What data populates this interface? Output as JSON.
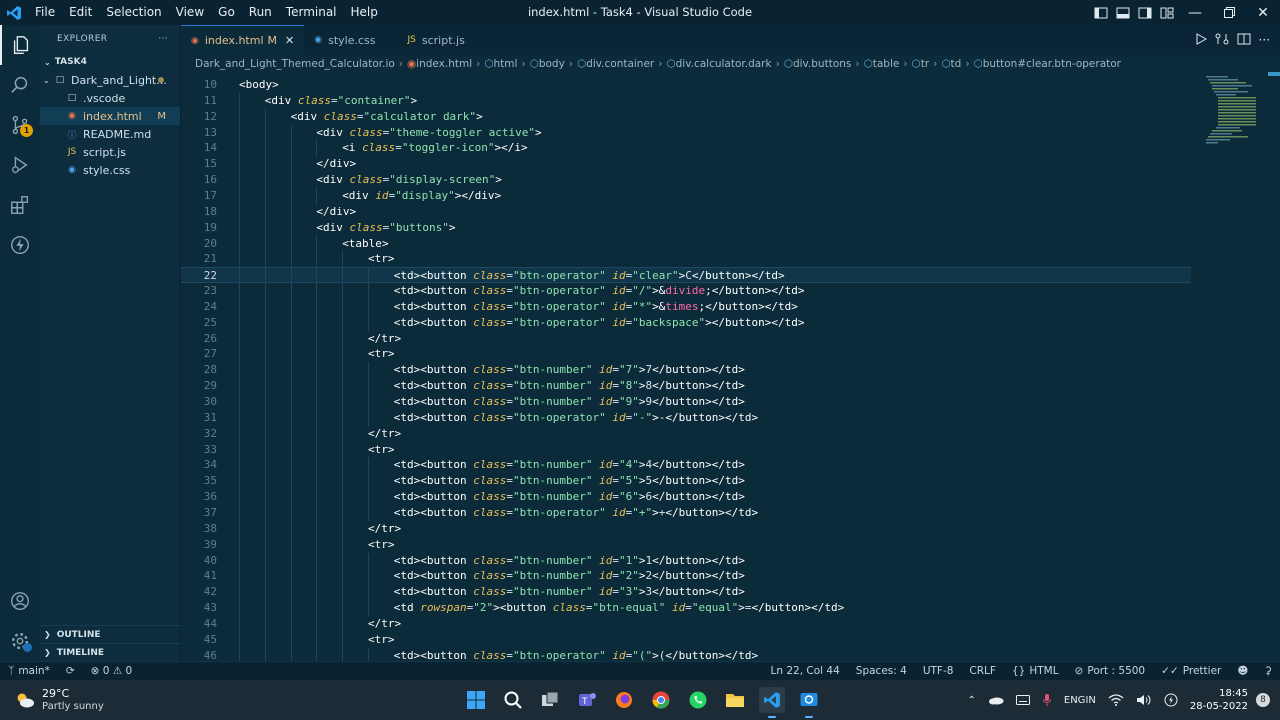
{
  "title_bar": {
    "menu": [
      "File",
      "Edit",
      "Selection",
      "View",
      "Go",
      "Run",
      "Terminal",
      "Help"
    ],
    "window_title": "index.html - Task4 - Visual Studio Code"
  },
  "activity_bar": {
    "scm_badge": "1"
  },
  "sidebar": {
    "header": "EXPLORER",
    "more": "···",
    "section": "TASK4",
    "tree": [
      {
        "label": "Dark_and_Light...",
        "type": "folder"
      },
      {
        "label": ".vscode",
        "type": "folder"
      },
      {
        "label": "index.html",
        "type": "html",
        "status": "M"
      },
      {
        "label": "README.md",
        "type": "md"
      },
      {
        "label": "script.js",
        "type": "js"
      },
      {
        "label": "style.css",
        "type": "css"
      }
    ],
    "outline": "OUTLINE",
    "timeline": "TIMELINE"
  },
  "tabs": [
    {
      "label": "index.html",
      "status": "M",
      "icon": "html-file-icon"
    },
    {
      "label": "style.css",
      "icon": "css-file-icon"
    },
    {
      "label": "script.js",
      "icon": "js-file-icon"
    }
  ],
  "breadcrumb": [
    "Dark_and_Light_Themed_Calculator.io",
    "index.html",
    "html",
    "body",
    "div.container",
    "div.calculator.dark",
    "div.buttons",
    "table",
    "tr",
    "td",
    "button#clear.btn-operator"
  ],
  "editor": {
    "current_line": 22,
    "lines": [
      {
        "n": 10,
        "indent": 0,
        "text": "<body>"
      },
      {
        "n": 11,
        "indent": 1,
        "text": "<div class=\"container\">"
      },
      {
        "n": 12,
        "indent": 2,
        "text": "<div class=\"calculator dark\">"
      },
      {
        "n": 13,
        "indent": 3,
        "text": "<div class=\"theme-toggler active\">"
      },
      {
        "n": 14,
        "indent": 4,
        "text": "<i class=\"toggler-icon\"></i>"
      },
      {
        "n": 15,
        "indent": 3,
        "text": "</div>"
      },
      {
        "n": 16,
        "indent": 3,
        "text": "<div class=\"display-screen\">"
      },
      {
        "n": 17,
        "indent": 4,
        "text": "<div id=\"display\"></div>"
      },
      {
        "n": 18,
        "indent": 3,
        "text": "</div>"
      },
      {
        "n": 19,
        "indent": 3,
        "text": "<div class=\"buttons\">"
      },
      {
        "n": 20,
        "indent": 4,
        "text": "<table>"
      },
      {
        "n": 21,
        "indent": 5,
        "text": "<tr>"
      },
      {
        "n": 22,
        "indent": 6,
        "text": "<td><button class=\"btn-operator\" id=\"clear\">C</button></td>"
      },
      {
        "n": 23,
        "indent": 6,
        "text": "<td><button class=\"btn-operator\" id=\"/\">&divide;</button></td>"
      },
      {
        "n": 24,
        "indent": 6,
        "text": "<td><button class=\"btn-operator\" id=\"*\">&times;</button></td>"
      },
      {
        "n": 25,
        "indent": 6,
        "text": "<td><button class=\"btn-operator\" id=\"backspace\"></button></td>"
      },
      {
        "n": 26,
        "indent": 5,
        "text": "</tr>"
      },
      {
        "n": 27,
        "indent": 5,
        "text": "<tr>"
      },
      {
        "n": 28,
        "indent": 6,
        "text": "<td><button class=\"btn-number\" id=\"7\">7</button></td>"
      },
      {
        "n": 29,
        "indent": 6,
        "text": "<td><button class=\"btn-number\" id=\"8\">8</button></td>"
      },
      {
        "n": 30,
        "indent": 6,
        "text": "<td><button class=\"btn-number\" id=\"9\">9</button></td>"
      },
      {
        "n": 31,
        "indent": 6,
        "text": "<td><button class=\"btn-operator\" id=\"-\">-</button></td>"
      },
      {
        "n": 32,
        "indent": 5,
        "text": "</tr>"
      },
      {
        "n": 33,
        "indent": 5,
        "text": "<tr>"
      },
      {
        "n": 34,
        "indent": 6,
        "text": "<td><button class=\"btn-number\" id=\"4\">4</button></td>"
      },
      {
        "n": 35,
        "indent": 6,
        "text": "<td><button class=\"btn-number\" id=\"5\">5</button></td>"
      },
      {
        "n": 36,
        "indent": 6,
        "text": "<td><button class=\"btn-number\" id=\"6\">6</button></td>"
      },
      {
        "n": 37,
        "indent": 6,
        "text": "<td><button class=\"btn-operator\" id=\"+\">+</button></td>"
      },
      {
        "n": 38,
        "indent": 5,
        "text": "</tr>"
      },
      {
        "n": 39,
        "indent": 5,
        "text": "<tr>"
      },
      {
        "n": 40,
        "indent": 6,
        "text": "<td><button class=\"btn-number\" id=\"1\">1</button></td>"
      },
      {
        "n": 41,
        "indent": 6,
        "text": "<td><button class=\"btn-number\" id=\"2\">2</button></td>"
      },
      {
        "n": 42,
        "indent": 6,
        "text": "<td><button class=\"btn-number\" id=\"3\">3</button></td>"
      },
      {
        "n": 43,
        "indent": 6,
        "text": "<td rowspan=\"2\"><button class=\"btn-equal\" id=\"equal\">=</button></td>"
      },
      {
        "n": 44,
        "indent": 5,
        "text": "</tr>"
      },
      {
        "n": 45,
        "indent": 5,
        "text": "<tr>"
      },
      {
        "n": 46,
        "indent": 6,
        "text": "<td><button class=\"btn-operator\" id=\"(\">(</button></td>"
      }
    ]
  },
  "status_bar": {
    "branch": "main*",
    "problems": "⊗ 0 ⚠ 0",
    "cursor": "Ln 22, Col 44",
    "spaces": "Spaces: 4",
    "encoding": "UTF-8",
    "eol": "CRLF",
    "language": "HTML",
    "port": "Port : 5500",
    "prettier": "Prettier"
  },
  "taskbar": {
    "temp": "29°C",
    "condition": "Partly sunny",
    "lang_1": "ENG",
    "lang_2": "IN",
    "time": "18:45",
    "date": "28-05-2022",
    "notifications": "8"
  },
  "colors": {
    "accent": "#2b7bd6",
    "tag": "#ffffff",
    "attr": "#e8c05a",
    "string": "#8fe3b0",
    "entity": "#ff6ba8"
  }
}
